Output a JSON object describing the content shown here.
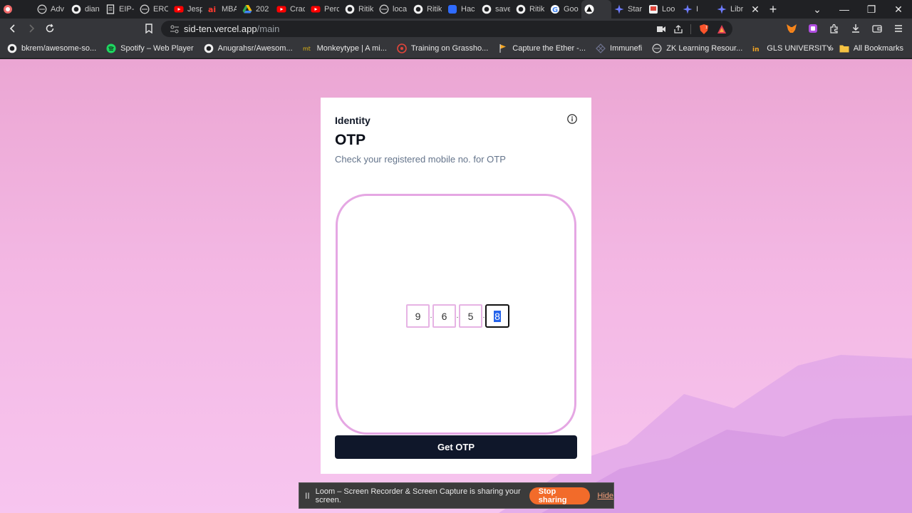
{
  "browser": {
    "tabs": [
      {
        "title": "",
        "icon": "record-icon"
      },
      {
        "title": "Adv",
        "icon": "globe-icon"
      },
      {
        "title": "dian",
        "icon": "github-icon"
      },
      {
        "title": "EIP-",
        "icon": "document-icon"
      },
      {
        "title": "ERC",
        "icon": "globe-icon"
      },
      {
        "title": "Jesp",
        "icon": "youtube-icon"
      },
      {
        "title": "MBA",
        "icon": "ai-icon"
      },
      {
        "title": "202",
        "icon": "drive-icon"
      },
      {
        "title": "Crac",
        "icon": "youtube-icon"
      },
      {
        "title": "Perc",
        "icon": "youtube-icon"
      },
      {
        "title": "Ritik",
        "icon": "github-icon"
      },
      {
        "title": "loca",
        "icon": "globe-icon"
      },
      {
        "title": "Ritik",
        "icon": "github-icon"
      },
      {
        "title": "Hac",
        "icon": "blue-square-icon"
      },
      {
        "title": "save",
        "icon": "github-icon"
      },
      {
        "title": "Ritik",
        "icon": "github-icon"
      },
      {
        "title": "Goo",
        "icon": "google-icon"
      },
      {
        "title": "",
        "icon": "triangle-icon",
        "active": true
      },
      {
        "title": "Star",
        "icon": "starknet-icon"
      },
      {
        "title": "Loo",
        "icon": "loom-icon"
      },
      {
        "title": "I",
        "icon": "starknet-icon"
      },
      {
        "title": "Libr",
        "icon": "starknet-icon"
      }
    ],
    "url": {
      "host": "sid-ten.vercel.app",
      "path": "/main"
    },
    "bookmarks": [
      {
        "label": "bkrem/awesome-so...",
        "icon": "github-icon"
      },
      {
        "label": "Spotify – Web Player",
        "icon": "spotify-icon"
      },
      {
        "label": "Anugrahsr/Awesom...",
        "icon": "github-icon"
      },
      {
        "label": "Monkeytype | A mi...",
        "icon": "monkeytype-icon"
      },
      {
        "label": "Training on Grassho...",
        "icon": "grasshopper-icon"
      },
      {
        "label": "Capture the Ether -...",
        "icon": "flag-icon"
      },
      {
        "label": "Immunefi",
        "icon": "immunefi-icon"
      },
      {
        "label": "ZK Learning Resour...",
        "icon": "globe-icon"
      },
      {
        "label": "GLS UNIVERSITY",
        "icon": "gls-icon"
      }
    ],
    "bookmarks_more": "»",
    "all_bookmarks": "All Bookmarks"
  },
  "card": {
    "eyebrow": "Identity",
    "title": "OTP",
    "subtitle": "Check your registered mobile no. for OTP",
    "otp_digits": [
      "9",
      "6",
      "5",
      "8"
    ],
    "otp_separator": ".",
    "button_label": "Get OTP"
  },
  "share_bar": {
    "text": "Loom – Screen Recorder & Screen Capture is sharing your screen.",
    "stop_label": "Stop sharing",
    "hide_label": "Hide",
    "pause_symbol": "II"
  },
  "colors": {
    "accent_button": "#0f172a",
    "otp_frame": "#e5a7e3",
    "stop_sharing": "#f26b2a"
  }
}
